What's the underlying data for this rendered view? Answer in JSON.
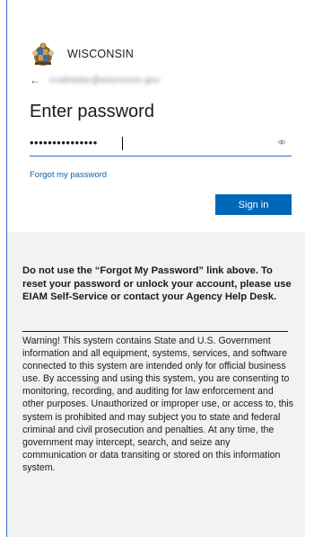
{
  "brand": {
    "logo_text": "WISCONSIN",
    "seal_icon": "wisconsin-seal-icon"
  },
  "account": {
    "back_icon": "back-arrow-icon",
    "email_display": "ccabtadar@wisconsin.gov"
  },
  "page": {
    "title": "Enter password"
  },
  "password": {
    "value": "•••••••••••••••",
    "reveal_icon": "eye-icon"
  },
  "links": {
    "forgot_password": "Forgot my password"
  },
  "buttons": {
    "sign_in": "Sign in"
  },
  "notice": {
    "bold_text": "Do not use the “Forgot My Password” link above. To reset your password or unlock your account, please use EIAM Self-Service or contact your Agency Help Desk.",
    "warning_text": "Warning! This system contains State and U.S. Government information and all equipment, systems, services, and software connected to this system are intended only for official business use. By accessing and using this system, you are consenting to monitoring, recording, and auditing for law enforcement and other purposes. Unauthorized or improper use, or access to, this system is prohibited and may subject you to state and federal criminal and civil prosecution and penalties. At any time, the government may intercept, search, and seize any communication or data transiting or stored on this information system."
  },
  "colors": {
    "accent": "#0067b8",
    "input_underline": "#2f6ccf",
    "notice_bg": "#f2f2f2"
  }
}
